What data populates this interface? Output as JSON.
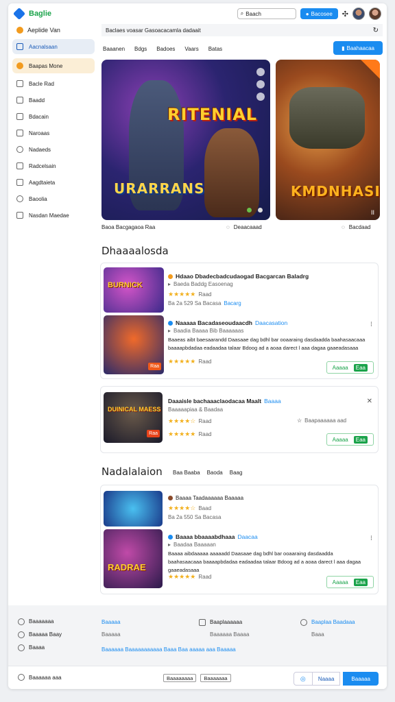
{
  "header": {
    "brand": "Baglie",
    "search_placeholder": "Baach",
    "action_button": "Bacosee"
  },
  "sidebar": {
    "title": "Aeplide Van",
    "items": [
      {
        "label": "Aacnalsaan"
      },
      {
        "label": "Baapas Mone"
      },
      {
        "label": "Bacle Rad"
      },
      {
        "label": "Baadd"
      },
      {
        "label": "Bdacain"
      },
      {
        "label": "Naroaas"
      },
      {
        "label": "Nadaeds"
      },
      {
        "label": "Radcelsain"
      },
      {
        "label": "Aagdtaieta"
      },
      {
        "label": "Baoolia"
      },
      {
        "label": "Nasdan Maedae"
      }
    ]
  },
  "breadcrumb": "Baclaes voasar Gasoacacamla dadaait",
  "tabs": [
    "Baaanen",
    "Bdgs",
    "Badoes",
    "Vaars",
    "Batas"
  ],
  "cta_button": "Baahaacaa",
  "hero": {
    "left_title": "RITENIAL",
    "left_subtitle": "URARRANS",
    "right_title": "KMDNHASI",
    "caption_left": "Baoa Bacgagaoa Raa",
    "caption_mid": "Deaacaaad",
    "caption_right": "Bacdaad"
  },
  "section1": {
    "title": "Dhaaaalosda",
    "card1": {
      "thumb_title": "BURNICK",
      "title": "Hdaao Dbadecbadcudaogad Bacgarcan Baladrg",
      "subtitle": "Baeda Baddg Easoenag",
      "rating_label": "Raad",
      "meta": "Ba 2a 529 Sa Bacasa",
      "meta_link": "Bacarg",
      "item2_title": "Naaaaa Bacadaseoudaacdh",
      "item2_link": "Daacasation",
      "item2_sub": "Baadia Baaaa Bib Baaaaaas",
      "item2_desc": "Baaeas aibt baesaarandd Daasaae dag bdhl bar ooaaraing dasdaadda baahasaacaaa baaaapbdadaa eadaadaa talaar Bdoog ad a aoaa darect l aaa dagaa gaaeadasaaa",
      "item2_rating": "Raad",
      "badge": "Raa",
      "button": "Aaaaa",
      "button_chip": "Eaa"
    },
    "card2": {
      "thumb_title": "DUINICAL MAESS",
      "title": "Daaaisle bachaaaclaodacaa Maalt",
      "title_link": "Baaaa",
      "subtitle": "Baaaaapiaa & Baadaa",
      "rating1": "Raad",
      "rating2": "Raad",
      "favorite": "Baapaaaaaa aad",
      "badge": "Raa",
      "button": "Aaaaa",
      "button_chip": "Eaa"
    }
  },
  "section2": {
    "title": "Nadalalaion",
    "tags": [
      "Baa Baaba",
      "Baoda",
      "Baag"
    ],
    "card1": {
      "title": "Baaaa Taadaaaaaa Baaaaa",
      "rating": "Baad",
      "meta": "Ba 2a 550 Sa Bacasa",
      "item2_title": "Baaaa bbaaaabdhaaa",
      "item2_link": "Daacaa",
      "item2_sub": "Baadaa Baaaaan",
      "item2_desc": "Baaaa aibdaaaaa aaaaadd Daasaae dag bdhl bar ooaaraing dasdaadda baahasaacaaa baaaapbdadaa eadaadaa talaar Bdoog ad a aoaa darect l aaa dagaa gaaeadasaaa",
      "item2_rating": "Raad",
      "thumb_title": "RADRAE",
      "button": "Aaaaa",
      "button_chip": "Eaa"
    }
  },
  "footer": {
    "left": [
      "Baaaaaaa",
      "Baaaaa Baay",
      "Baaaa"
    ],
    "col2_head": "Baaaaa",
    "col2_sub": "Baaaaa",
    "col3_head": "Baaplaaaaaa",
    "col3_sub": "Baaaaaa Baaaa",
    "col4_head": "Baaplaa Baadaaa",
    "col4_sub": "Baaa",
    "link_line": "Baaaaaa Baaaaaaaaaaa Baaa Baa aaaaa aaa Baaaaa",
    "bottom_left": "Baaaaaa aaa",
    "mini1": "Baaaaaaaa",
    "mini2": "Baaaaaaa",
    "btn1": "Naaaa",
    "btn2": "Baaaaa"
  }
}
